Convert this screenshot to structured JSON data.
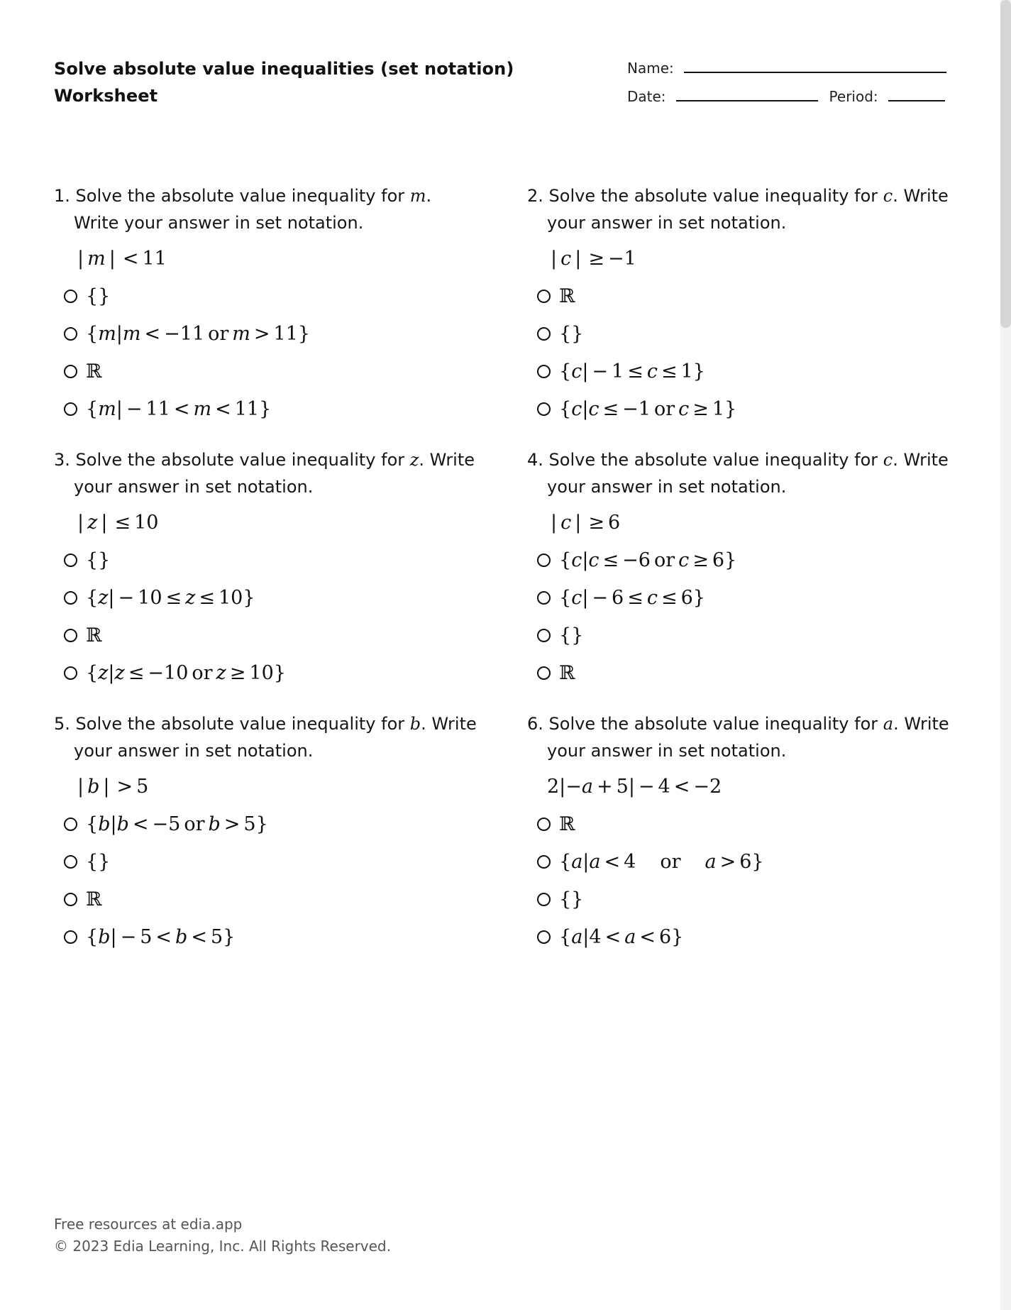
{
  "header": {
    "title_line1": "Solve absolute value inequalities (set notation)",
    "title_line2": "Worksheet",
    "name_label": "Name:",
    "date_label": "Date:",
    "period_label": "Period:"
  },
  "questions": [
    {
      "number": "1.",
      "prompt_before": "Solve the absolute value inequality for ",
      "variable": "m",
      "prompt_after": ". Write your answer in set notation.",
      "expression": [
        [
          "o",
          "|"
        ],
        [
          "v",
          "m"
        ],
        [
          "o",
          "|"
        ],
        [
          "o",
          "<"
        ],
        [
          "r",
          "11"
        ]
      ],
      "options": [
        [
          [
            "r",
            "{}"
          ]
        ],
        [
          [
            "r",
            "{"
          ],
          [
            "v",
            "m"
          ],
          [
            "r",
            "|"
          ],
          [
            "v",
            "m"
          ],
          [
            "o",
            "<"
          ],
          [
            "r",
            "−11"
          ],
          [
            "o",
            "or"
          ],
          [
            "v",
            "m"
          ],
          [
            "o",
            ">"
          ],
          [
            "r",
            "11}"
          ]
        ],
        [
          [
            "b",
            "ℝ"
          ]
        ],
        [
          [
            "r",
            "{"
          ],
          [
            "v",
            "m"
          ],
          [
            "r",
            "|"
          ],
          [
            "o",
            "−"
          ],
          [
            "r",
            "11"
          ],
          [
            "o",
            "<"
          ],
          [
            "v",
            "m"
          ],
          [
            "o",
            "<"
          ],
          [
            "r",
            "11}"
          ]
        ]
      ]
    },
    {
      "number": "2.",
      "prompt_before": "Solve the absolute value inequality for ",
      "variable": "c",
      "prompt_after": ". Write your answer in set notation.",
      "expression": [
        [
          "o",
          "|"
        ],
        [
          "v",
          "c"
        ],
        [
          "o",
          "|"
        ],
        [
          "o",
          "≥"
        ],
        [
          "r",
          "−1"
        ]
      ],
      "options": [
        [
          [
            "b",
            "ℝ"
          ]
        ],
        [
          [
            "r",
            "{}"
          ]
        ],
        [
          [
            "r",
            "{"
          ],
          [
            "v",
            "c"
          ],
          [
            "r",
            "|"
          ],
          [
            "o",
            "−"
          ],
          [
            "r",
            "1"
          ],
          [
            "o",
            "≤"
          ],
          [
            "v",
            "c"
          ],
          [
            "o",
            "≤"
          ],
          [
            "r",
            "1}"
          ]
        ],
        [
          [
            "r",
            "{"
          ],
          [
            "v",
            "c"
          ],
          [
            "r",
            "|"
          ],
          [
            "v",
            "c"
          ],
          [
            "o",
            "≤"
          ],
          [
            "r",
            "−1"
          ],
          [
            "o",
            "or"
          ],
          [
            "v",
            "c"
          ],
          [
            "o",
            "≥"
          ],
          [
            "r",
            "1}"
          ]
        ]
      ]
    },
    {
      "number": "3.",
      "prompt_before": "Solve the absolute value inequality for ",
      "variable": "z",
      "prompt_after": ". Write your answer in set notation.",
      "expression": [
        [
          "o",
          "|"
        ],
        [
          "v",
          "z"
        ],
        [
          "o",
          "|"
        ],
        [
          "o",
          "≤"
        ],
        [
          "r",
          "10"
        ]
      ],
      "options": [
        [
          [
            "r",
            "{}"
          ]
        ],
        [
          [
            "r",
            "{"
          ],
          [
            "v",
            "z"
          ],
          [
            "r",
            "|"
          ],
          [
            "o",
            "−"
          ],
          [
            "r",
            "10"
          ],
          [
            "o",
            "≤"
          ],
          [
            "v",
            "z"
          ],
          [
            "o",
            "≤"
          ],
          [
            "r",
            "10}"
          ]
        ],
        [
          [
            "b",
            "ℝ"
          ]
        ],
        [
          [
            "r",
            "{"
          ],
          [
            "v",
            "z"
          ],
          [
            "r",
            "|"
          ],
          [
            "v",
            "z"
          ],
          [
            "o",
            "≤"
          ],
          [
            "r",
            "−10"
          ],
          [
            "o",
            "or"
          ],
          [
            "v",
            "z"
          ],
          [
            "o",
            "≥"
          ],
          [
            "r",
            "10}"
          ]
        ]
      ]
    },
    {
      "number": "4.",
      "prompt_before": "Solve the absolute value inequality for ",
      "variable": "c",
      "prompt_after": ". Write your answer in set notation.",
      "expression": [
        [
          "o",
          "|"
        ],
        [
          "v",
          "c"
        ],
        [
          "o",
          "|"
        ],
        [
          "o",
          "≥"
        ],
        [
          "r",
          "6"
        ]
      ],
      "options": [
        [
          [
            "r",
            "{"
          ],
          [
            "v",
            "c"
          ],
          [
            "r",
            "|"
          ],
          [
            "v",
            "c"
          ],
          [
            "o",
            "≤"
          ],
          [
            "r",
            "−6"
          ],
          [
            "o",
            "or"
          ],
          [
            "v",
            "c"
          ],
          [
            "o",
            "≥"
          ],
          [
            "r",
            "6}"
          ]
        ],
        [
          [
            "r",
            "{"
          ],
          [
            "v",
            "c"
          ],
          [
            "r",
            "|"
          ],
          [
            "o",
            "−"
          ],
          [
            "r",
            "6"
          ],
          [
            "o",
            "≤"
          ],
          [
            "v",
            "c"
          ],
          [
            "o",
            "≤"
          ],
          [
            "r",
            "6}"
          ]
        ],
        [
          [
            "r",
            "{}"
          ]
        ],
        [
          [
            "b",
            "ℝ"
          ]
        ]
      ]
    },
    {
      "number": "5.",
      "prompt_before": "Solve the absolute value inequality for ",
      "variable": "b",
      "prompt_after": ". Write your answer in set notation.",
      "expression": [
        [
          "o",
          "|"
        ],
        [
          "v",
          "b"
        ],
        [
          "o",
          "|"
        ],
        [
          "o",
          ">"
        ],
        [
          "r",
          "5"
        ]
      ],
      "options": [
        [
          [
            "r",
            "{"
          ],
          [
            "v",
            "b"
          ],
          [
            "r",
            "|"
          ],
          [
            "v",
            "b"
          ],
          [
            "o",
            "<"
          ],
          [
            "r",
            "−5"
          ],
          [
            "o",
            "or"
          ],
          [
            "v",
            "b"
          ],
          [
            "o",
            ">"
          ],
          [
            "r",
            "5}"
          ]
        ],
        [
          [
            "r",
            "{}"
          ]
        ],
        [
          [
            "b",
            "ℝ"
          ]
        ],
        [
          [
            "r",
            "{"
          ],
          [
            "v",
            "b"
          ],
          [
            "r",
            "|"
          ],
          [
            "o",
            "−"
          ],
          [
            "r",
            "5"
          ],
          [
            "o",
            "<"
          ],
          [
            "v",
            "b"
          ],
          [
            "o",
            "<"
          ],
          [
            "r",
            "5}"
          ]
        ]
      ]
    },
    {
      "number": "6.",
      "prompt_before": "Solve the absolute value inequality for ",
      "variable": "a",
      "prompt_after": ". Write your answer in set notation.",
      "expression": [
        [
          "r",
          "2|−"
        ],
        [
          "v",
          "a"
        ],
        [
          "o",
          "+"
        ],
        [
          "r",
          "5|"
        ],
        [
          "o",
          "−"
        ],
        [
          "r",
          "4"
        ],
        [
          "o",
          "<"
        ],
        [
          "r",
          "−2"
        ]
      ],
      "options": [
        [
          [
            "b",
            "ℝ"
          ]
        ],
        [
          [
            "r",
            "{"
          ],
          [
            "v",
            "a"
          ],
          [
            "r",
            "|"
          ],
          [
            "v",
            "a"
          ],
          [
            "o",
            "<"
          ],
          [
            "r",
            "4"
          ],
          [
            "s",
            ""
          ],
          [
            "r",
            "or"
          ],
          [
            "s",
            ""
          ],
          [
            "v",
            "a"
          ],
          [
            "o",
            ">"
          ],
          [
            "r",
            "6}"
          ]
        ],
        [
          [
            "r",
            "{}"
          ]
        ],
        [
          [
            "r",
            "{"
          ],
          [
            "v",
            "a"
          ],
          [
            "r",
            "|4"
          ],
          [
            "o",
            "<"
          ],
          [
            "v",
            "a"
          ],
          [
            "o",
            "<"
          ],
          [
            "r",
            "6}"
          ]
        ]
      ]
    }
  ],
  "footer": {
    "line1": "Free resources at edia.app",
    "line2": "© 2023 Edia Learning, Inc. All Rights Reserved."
  },
  "colors": {
    "text": "#111111",
    "footer_text": "#555555",
    "scroll_thumb": "#d6d6d6",
    "scroll_track": "#f3f3f3"
  }
}
